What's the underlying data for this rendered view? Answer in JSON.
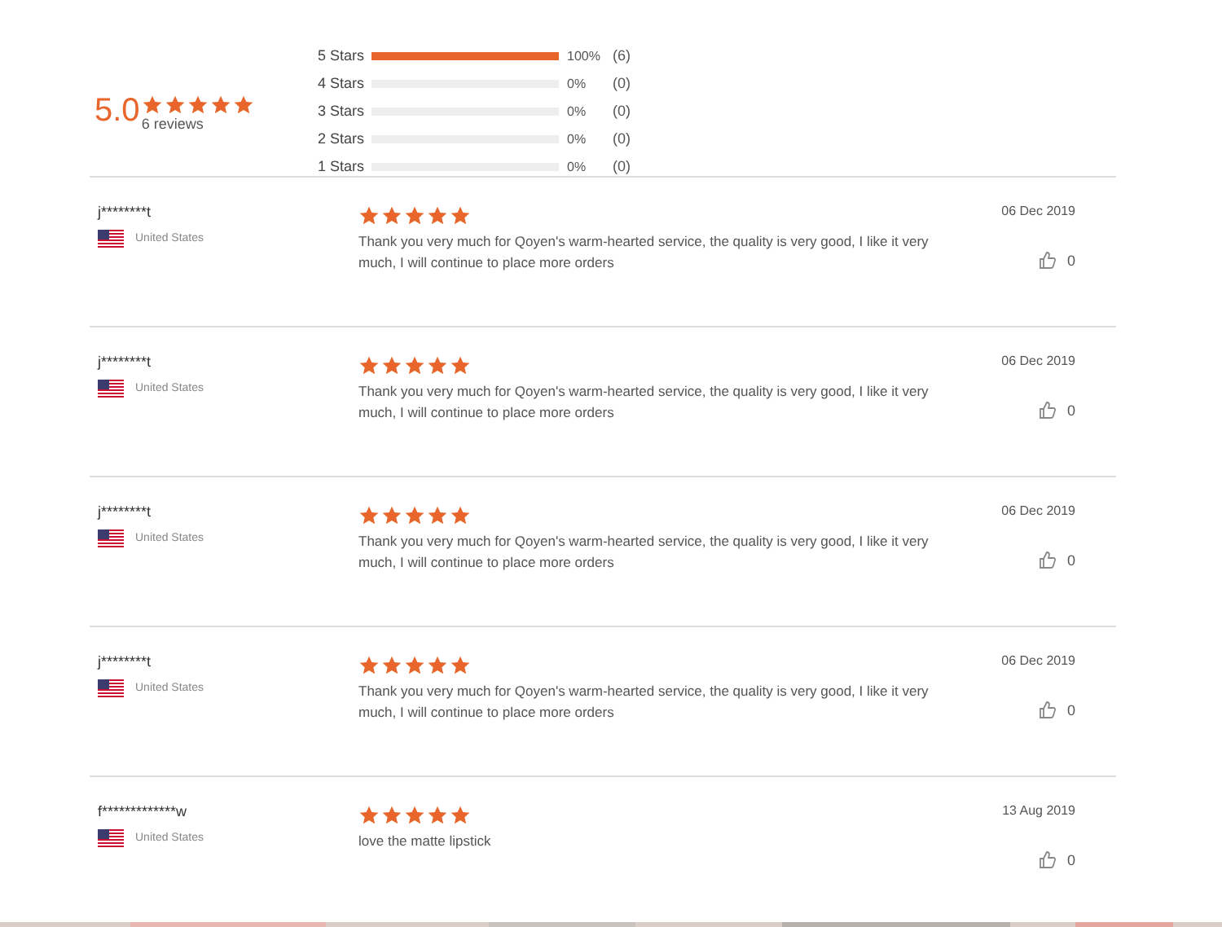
{
  "summary": {
    "score": "5.0",
    "stars": 5,
    "count": "6 reviews"
  },
  "breakdown": [
    {
      "label": "5 Stars",
      "level": 1,
      "percent": "100%",
      "count": "(6)"
    },
    {
      "label": "4 Stars",
      "percent": "0%",
      "count": "(0)"
    },
    {
      "label": "3 Stars",
      "percent": "0%",
      "count": "(0)"
    },
    {
      "label": "2 Stars",
      "percent": "0%",
      "count": "(0)"
    },
    {
      "label": "1 Stars",
      "percent": "0%",
      "count": "(0)"
    }
  ],
  "reviews": [
    {
      "name": "j********t",
      "country": "United States",
      "stars": 5,
      "text": "Thank you very much for Qoyen's warm-hearted service, the quality is very good, I like it very much, I will continue to place more orders",
      "date": "06 Dec 2019",
      "likes": "0"
    },
    {
      "name": "j********t",
      "country": "United States",
      "stars": 5,
      "text": "Thank you very much for Qoyen's warm-hearted service, the quality is very good, I like it very much, I will continue to place more orders",
      "date": "06 Dec 2019",
      "likes": "0"
    },
    {
      "name": "j********t",
      "country": "United States",
      "stars": 5,
      "text": "Thank you very much for Qoyen's warm-hearted service, the quality is very good, I like it very much, I will continue to place more orders",
      "date": "06 Dec 2019",
      "likes": "0"
    },
    {
      "name": "j********t",
      "country": "United States",
      "stars": 5,
      "text": "Thank you very much for Qoyen's warm-hearted service, the quality is very good, I like it very much, I will continue to place more orders",
      "date": "06 Dec 2019",
      "likes": "0"
    },
    {
      "name": "f*************w",
      "country": "United States",
      "stars": 5,
      "text": "love the matte lipstick",
      "date": "13 Aug 2019",
      "likes": "0"
    }
  ]
}
